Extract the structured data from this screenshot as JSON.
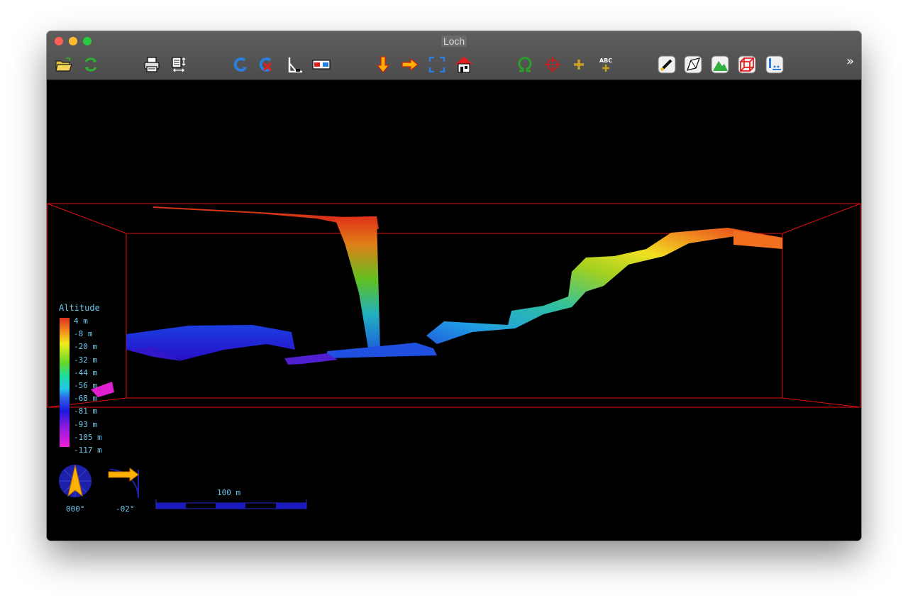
{
  "window": {
    "title": "Loch"
  },
  "toolbar": {
    "groups": [
      [
        "open-folder-icon",
        "reload-icon"
      ],
      [
        "print-icon",
        "render-setup-icon"
      ],
      [
        "rotate-icon",
        "cancel-rotate-icon",
        "measure-angle-icon",
        "stereo-glasses-icon"
      ],
      [
        "plan-view-icon",
        "elevation-view-icon",
        "zoom-extents-icon",
        "home-view-icon"
      ],
      [
        "omega-icon",
        "target-icon",
        "plus-icon",
        "label-plus-icon"
      ],
      [
        "centreline-icon",
        "walls-icon",
        "surface-icon",
        "bounding-box-icon",
        "indicators-icon"
      ]
    ],
    "overflow_label": "»",
    "label_icon_text": "ABC"
  },
  "legend": {
    "title": "Altitude",
    "labels": [
      "4 m",
      "-8 m",
      "-20 m",
      "-32 m",
      "-44 m",
      "-56 m",
      "-68 m",
      "-81 m",
      "-93 m",
      "-105 m",
      "-117 m"
    ],
    "colors": [
      "#e0301e",
      "#f08a1c",
      "#f2ee1c",
      "#62d72a",
      "#1edc9e",
      "#21c6ea",
      "#2f64e6",
      "#1a1ae0",
      "#8a1ae0",
      "#ef1fd6"
    ]
  },
  "compass": {
    "heading": "000°"
  },
  "tilt": {
    "angle": "-02°"
  },
  "scale": {
    "label": "100 m"
  },
  "colors": {
    "bbox": "#e01010",
    "hud_text": "#6fc9ee",
    "background": "#000000"
  }
}
